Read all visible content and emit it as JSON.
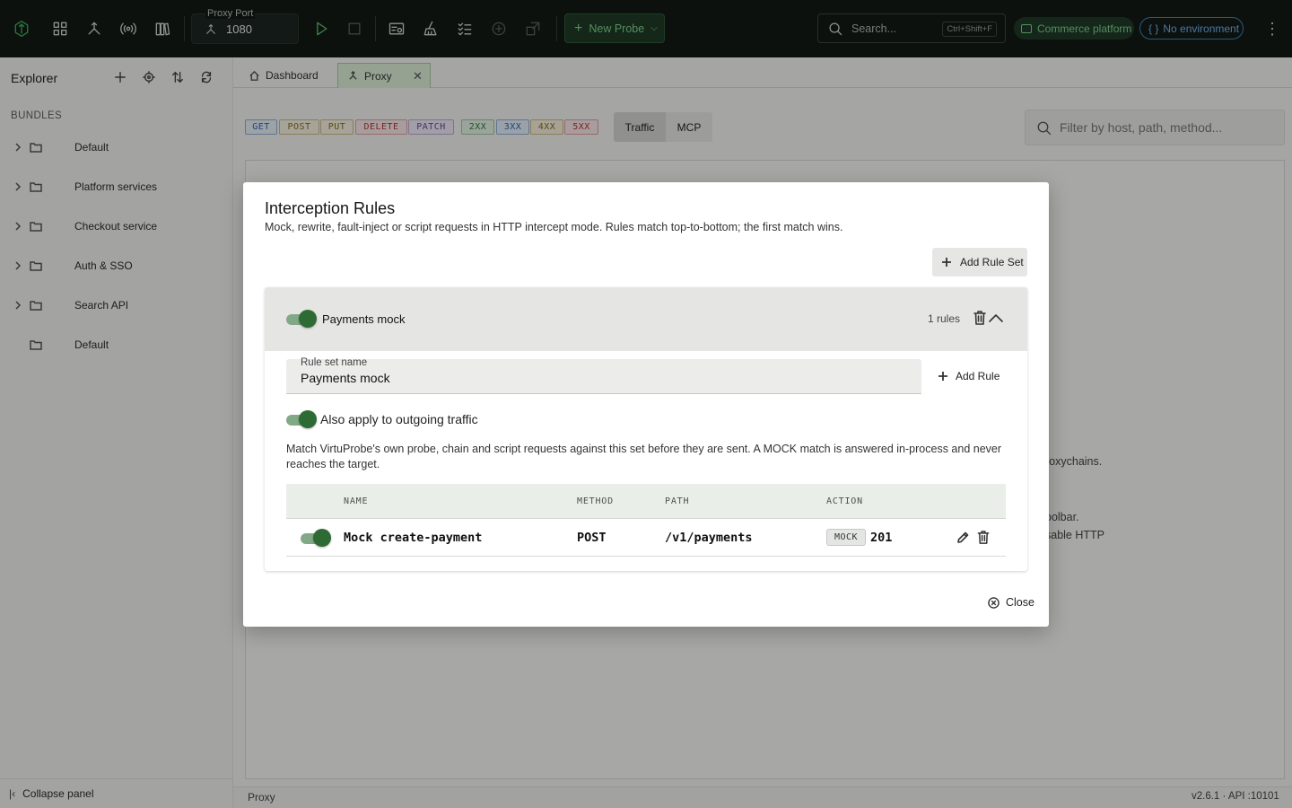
{
  "topbar": {
    "proxy_port_label": "Proxy Port",
    "proxy_port_value": "1080",
    "new_probe_label": "New Probe",
    "search_placeholder": "Search...",
    "search_shortcut": "Ctrl+Shift+F",
    "workspace_label": "Commerce platform",
    "environment_label": "No environment",
    "environment_icon_text": "{ }"
  },
  "sidebar": {
    "title": "Explorer",
    "section": "BUNDLES",
    "bundles": [
      {
        "name": "Default",
        "expandable": true
      },
      {
        "name": "Platform services",
        "expandable": true
      },
      {
        "name": "Checkout service",
        "expandable": true
      },
      {
        "name": "Auth & SSO",
        "expandable": true
      },
      {
        "name": "Search API",
        "expandable": true
      },
      {
        "name": "Default",
        "expandable": false
      }
    ],
    "collapse_label": "Collapse panel"
  },
  "tabs": [
    {
      "label": "Dashboard",
      "icon": "home-icon",
      "active": false
    },
    {
      "label": "Proxy",
      "icon": "proxy-icon",
      "active": true
    }
  ],
  "filters": {
    "methods": [
      "GET",
      "POST",
      "PUT",
      "DELETE",
      "PATCH"
    ],
    "statuses": [
      "2XX",
      "3XX",
      "4XX",
      "5XX"
    ],
    "modes": [
      "Traffic",
      "MCP"
    ],
    "active_mode": "Traffic",
    "filter_placeholder": "Filter by host, path, method..."
  },
  "background_text": {
    "line1": "roxychains.",
    "line2": "oolbar.",
    "line3": "sable HTTP"
  },
  "statusbar": {
    "left": "Proxy",
    "right": "v2.6.1  · API :10101"
  },
  "dialog": {
    "title": "Interception Rules",
    "description": "Mock, rewrite, fault-inject or script requests in HTTP intercept mode. Rules match top-to-bottom; the first match wins.",
    "add_rule_set_label": "Add Rule Set",
    "rule_set": {
      "name": "Payments mock",
      "enabled": true,
      "rule_count": "1 rules",
      "name_field_label": "Rule set name",
      "name_field_value": "Payments mock",
      "add_rule_label": "Add Rule",
      "outgoing_label": "Also apply to outgoing traffic",
      "outgoing_enabled": true,
      "outgoing_description": "Match VirtuProbe's own probe, chain and script requests against this set before they are sent. A MOCK match is answered in-process and never reaches the target.",
      "columns": [
        "NAME",
        "METHOD",
        "PATH",
        "ACTION"
      ],
      "rules": [
        {
          "enabled": true,
          "name": "Mock create-payment",
          "method": "POST",
          "path": "/v1/payments",
          "action_type": "MOCK",
          "action_status": "201"
        }
      ]
    },
    "close_label": "Close"
  },
  "colors": {
    "brand_green": "#2e6b34",
    "topbar_bg": "#121a16",
    "env_blue": "#3f7fc0"
  }
}
